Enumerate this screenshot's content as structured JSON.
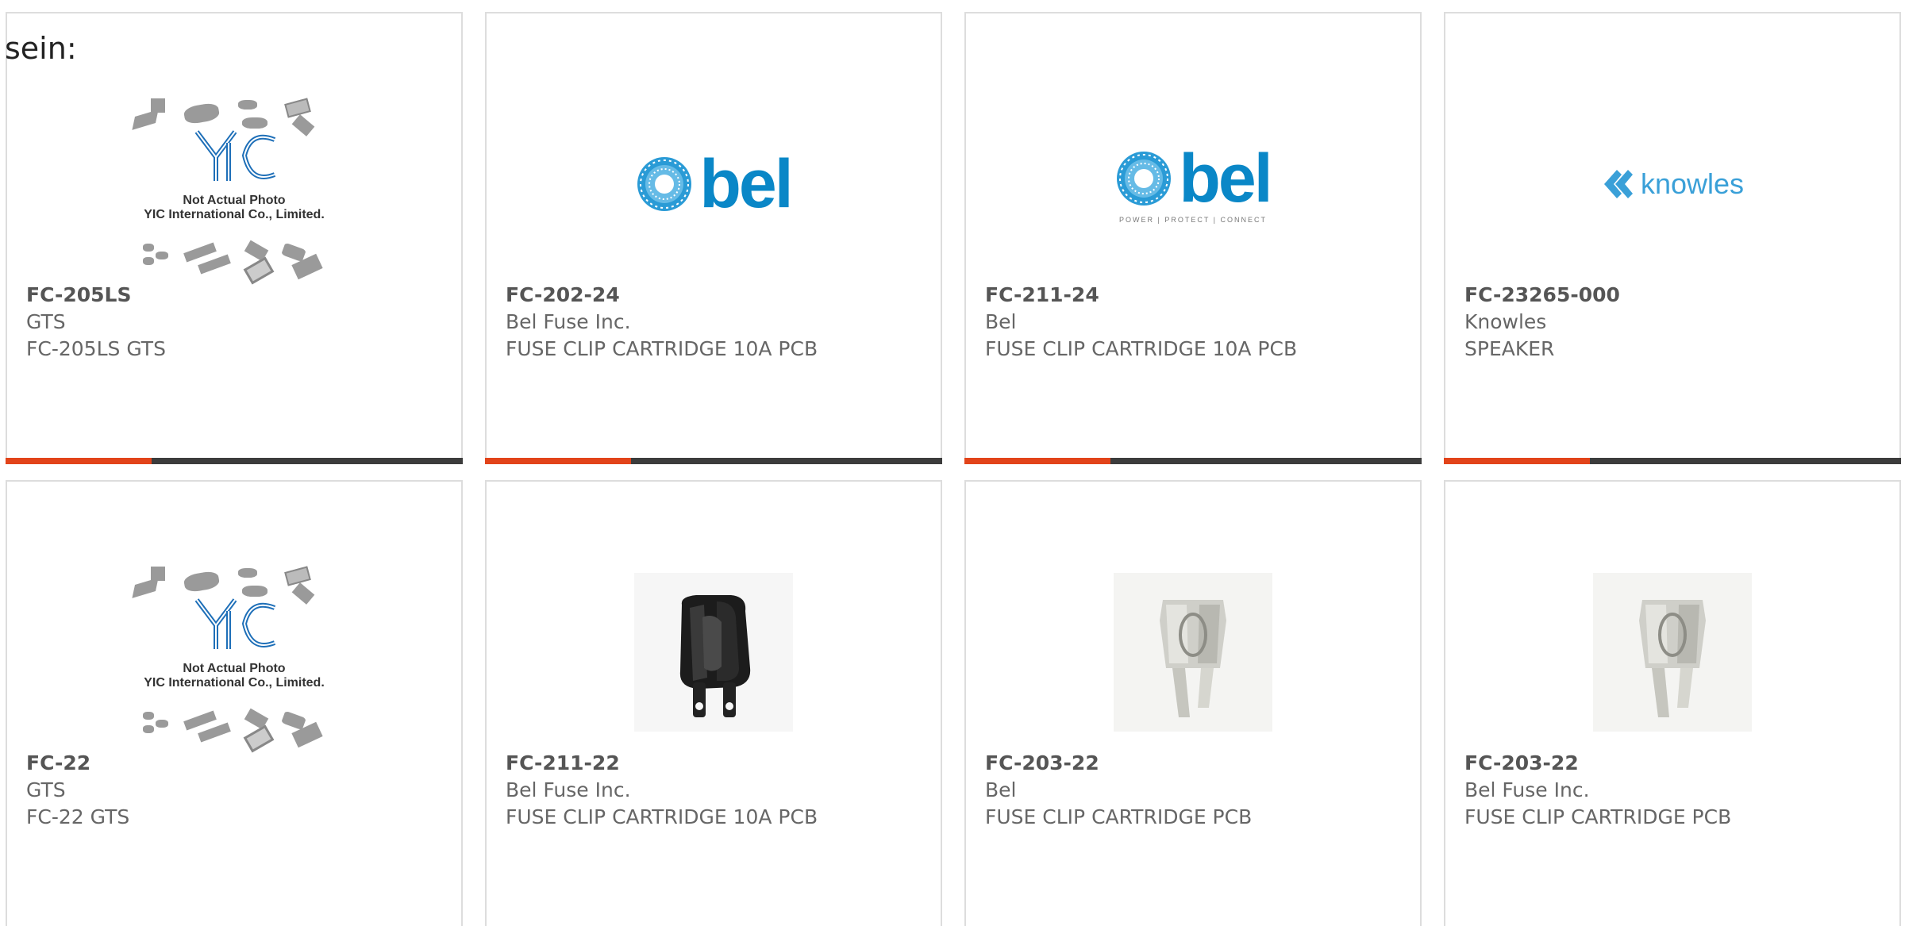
{
  "intro": "sein:",
  "products": [
    {
      "part": "FC-205LS",
      "manufacturer": "GTS",
      "description": "FC-205LS GTS",
      "image": "yic-placeholder"
    },
    {
      "part": "FC-202-24",
      "manufacturer": "Bel Fuse Inc.",
      "description": "FUSE CLIP CARTRIDGE 10A PCB",
      "image": "bel-logo"
    },
    {
      "part": "FC-211-24",
      "manufacturer": "Bel",
      "description": "FUSE CLIP CARTRIDGE 10A PCB",
      "image": "bel-logo-tagline"
    },
    {
      "part": "FC-23265-000",
      "manufacturer": "Knowles",
      "description": "SPEAKER",
      "image": "knowles-logo"
    },
    {
      "part": "FC-22",
      "manufacturer": "GTS",
      "description": "FC-22 GTS",
      "image": "yic-placeholder"
    },
    {
      "part": "FC-211-22",
      "manufacturer": "Bel Fuse Inc.",
      "description": "FUSE CLIP CARTRIDGE 10A PCB",
      "image": "black-fuse-clip-photo"
    },
    {
      "part": "FC-203-22",
      "manufacturer": "Bel",
      "description": "FUSE CLIP CARTRIDGE PCB",
      "image": "silver-fuse-clip-photo"
    },
    {
      "part": "FC-203-22",
      "manufacturer": "Bel Fuse Inc.",
      "description": "FUSE CLIP CARTRIDGE PCB",
      "image": "silver-fuse-clip-photo"
    }
  ],
  "placeholder": {
    "brand": "YIC",
    "line1": "Not Actual Photo",
    "line2": "YIC International Co., Limited."
  },
  "logos": {
    "bel": "bel",
    "bel_tagline": "POWER | PROTECT | CONNECT",
    "knowles": "knowles"
  },
  "colors": {
    "accent": "#e2441a",
    "bar": "#3c3c3c",
    "bel_blue": "#0a87c7",
    "knowles_blue": "#3aa0d8"
  }
}
